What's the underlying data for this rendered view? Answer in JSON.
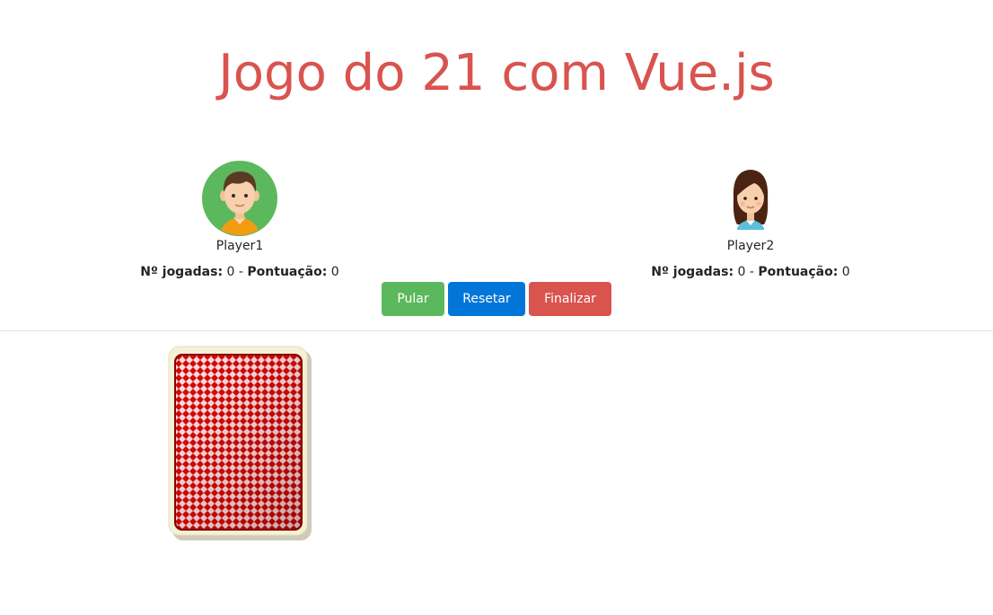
{
  "header": {
    "title": "Jogo do 21 com Vue.js"
  },
  "players": [
    {
      "name": "Player1",
      "avatar_icon": "boy-avatar-icon",
      "plays_label": "Nº jogadas:",
      "plays_value": "0",
      "separator": "-",
      "score_label": "Pontuação:",
      "score_value": "0"
    },
    {
      "name": "Player2",
      "avatar_icon": "girl-avatar-icon",
      "plays_label": "Nº jogadas:",
      "plays_value": "0",
      "separator": "-",
      "score_label": "Pontuação:",
      "score_value": "0"
    }
  ],
  "controls": {
    "pular_label": "Pular",
    "resetar_label": "Resetar",
    "finalizar_label": "Finalizar"
  },
  "board": {
    "deck_icon": "card-back-icon"
  },
  "colors": {
    "title": "#d9534f",
    "pular": "#5cb85c",
    "resetar": "#0275d8",
    "finalizar": "#d9534f",
    "active_player_ring": "#5cb85c",
    "card_back": "#cc0000",
    "card_border": "#f5f1d6"
  }
}
